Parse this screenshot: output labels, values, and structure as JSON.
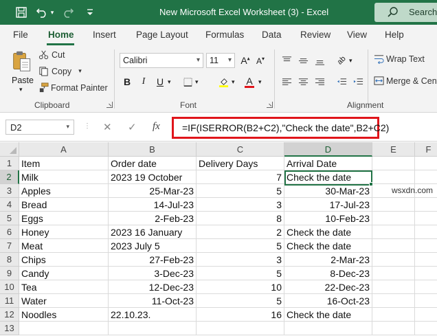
{
  "window": {
    "title": "New Microsoft Excel Worksheet (3)  -  Excel",
    "search_label": "Search"
  },
  "ribbon_tabs": [
    "File",
    "Home",
    "Insert",
    "Page Layout",
    "Formulas",
    "Data",
    "Review",
    "View",
    "Help"
  ],
  "active_tab": "Home",
  "clipboard": {
    "paste": "Paste",
    "cut": "Cut",
    "copy": "Copy",
    "format_painter": "Format Painter",
    "group_label": "Clipboard"
  },
  "font": {
    "name": "Calibri",
    "size": "11",
    "group_label": "Font"
  },
  "alignment": {
    "wrap_text": "Wrap Text",
    "merge_center": "Merge & Center",
    "group_label": "Alignment"
  },
  "formula_bar": {
    "name_box": "D2",
    "formula": "=IF(ISERROR(B2+C2),\"Check the date\",B2+C2)"
  },
  "sheet": {
    "columns": [
      "A",
      "B",
      "C",
      "D",
      "E",
      "F"
    ],
    "selected_column": "D",
    "selected_row": "2",
    "rows": [
      {
        "n": "1",
        "a": "Item",
        "b": "Order date",
        "c": "Delivery Days",
        "d": "Arrival Date"
      },
      {
        "n": "2",
        "a": "Milk",
        "b": "2023 19 October",
        "c": "7",
        "d": "Check the date"
      },
      {
        "n": "3",
        "a": "Apples",
        "b": "25-Mar-23",
        "c": "5",
        "d": "30-Mar-23"
      },
      {
        "n": "4",
        "a": "Bread",
        "b": "14-Jul-23",
        "c": "3",
        "d": "17-Jul-23"
      },
      {
        "n": "5",
        "a": "Eggs",
        "b": "2-Feb-23",
        "c": "8",
        "d": "10-Feb-23"
      },
      {
        "n": "6",
        "a": "Honey",
        "b": "2023 16 January",
        "c": "2",
        "d": "Check the date"
      },
      {
        "n": "7",
        "a": "Meat",
        "b": "2023 July 5",
        "c": "5",
        "d": "Check the date"
      },
      {
        "n": "8",
        "a": "Chips",
        "b": "27-Feb-23",
        "c": "3",
        "d": "2-Mar-23"
      },
      {
        "n": "9",
        "a": "Candy",
        "b": "3-Dec-23",
        "c": "5",
        "d": "8-Dec-23"
      },
      {
        "n": "10",
        "a": "Tea",
        "b": "12-Dec-23",
        "c": "10",
        "d": "22-Dec-23"
      },
      {
        "n": "11",
        "a": "Water",
        "b": "11-Oct-23",
        "c": "5",
        "d": "16-Oct-23"
      },
      {
        "n": "12",
        "a": "Noodles",
        "b": "22.10.23.",
        "c": "16",
        "d": "Check the date"
      },
      {
        "n": "13",
        "a": "",
        "b": "",
        "c": "",
        "d": ""
      }
    ]
  },
  "watermark": "wsxdn.com",
  "colors": {
    "excel_green": "#217346",
    "highlight_red": "#e0151b"
  }
}
